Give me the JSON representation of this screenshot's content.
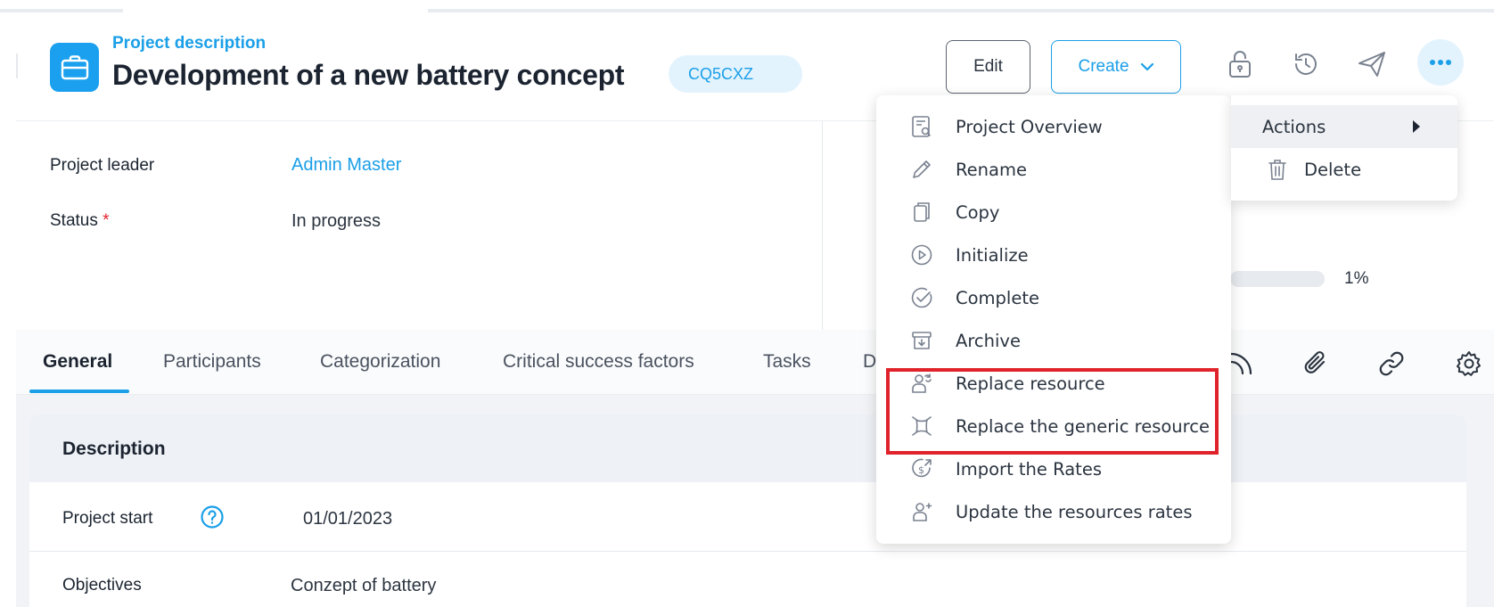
{
  "header": {
    "subtitle": "Project description",
    "title": "Development of a new battery concept",
    "code": "CQ5CXZ",
    "edit_label": "Edit",
    "create_label": "Create",
    "icons": [
      "lock-icon",
      "history-icon",
      "send-icon",
      "more-icon"
    ]
  },
  "info": {
    "project_leader_label": "Project leader",
    "project_leader_value": "Admin Master",
    "status_label": "Status",
    "status_required": "*",
    "status_value": "In progress",
    "progress_label": "1%",
    "progress_value": 0.01
  },
  "tabs": [
    {
      "label": "General",
      "active": true
    },
    {
      "label": "Participants"
    },
    {
      "label": "Categorization"
    },
    {
      "label": "Critical success factors"
    },
    {
      "label": "Tasks"
    },
    {
      "label": "D"
    }
  ],
  "tab_icons": [
    "rss-icon",
    "attachment-icon",
    "link-icon",
    "settings-icon"
  ],
  "description": {
    "title": "Description",
    "project_start_label": "Project start",
    "project_start_value": "01/01/2023",
    "objectives_label": "Objectives",
    "objectives_value": "Conzept of battery"
  },
  "menu": {
    "items": [
      {
        "label": "Project Overview",
        "icon": "overview-icon"
      },
      {
        "label": "Rename",
        "icon": "pencil-icon"
      },
      {
        "label": "Copy",
        "icon": "copy-icon"
      },
      {
        "label": "Initialize",
        "icon": "play-icon"
      },
      {
        "label": "Complete",
        "icon": "check-circle-icon"
      },
      {
        "label": "Archive",
        "icon": "archive-icon"
      },
      {
        "label": "Replace resource",
        "icon": "replace-resource-icon",
        "highlighted": true
      },
      {
        "label": "Replace the generic resource",
        "icon": "generic-resource-icon",
        "highlighted": true
      },
      {
        "label": "Import the Rates",
        "icon": "import-rates-icon"
      },
      {
        "label": "Update the resources rates",
        "icon": "update-rates-icon"
      }
    ]
  },
  "submenu": {
    "actions_label": "Actions",
    "delete_label": "Delete"
  },
  "colors": {
    "accent": "#1a9fe8",
    "required": "#e0222b",
    "highlight_border": "#e0222b"
  }
}
